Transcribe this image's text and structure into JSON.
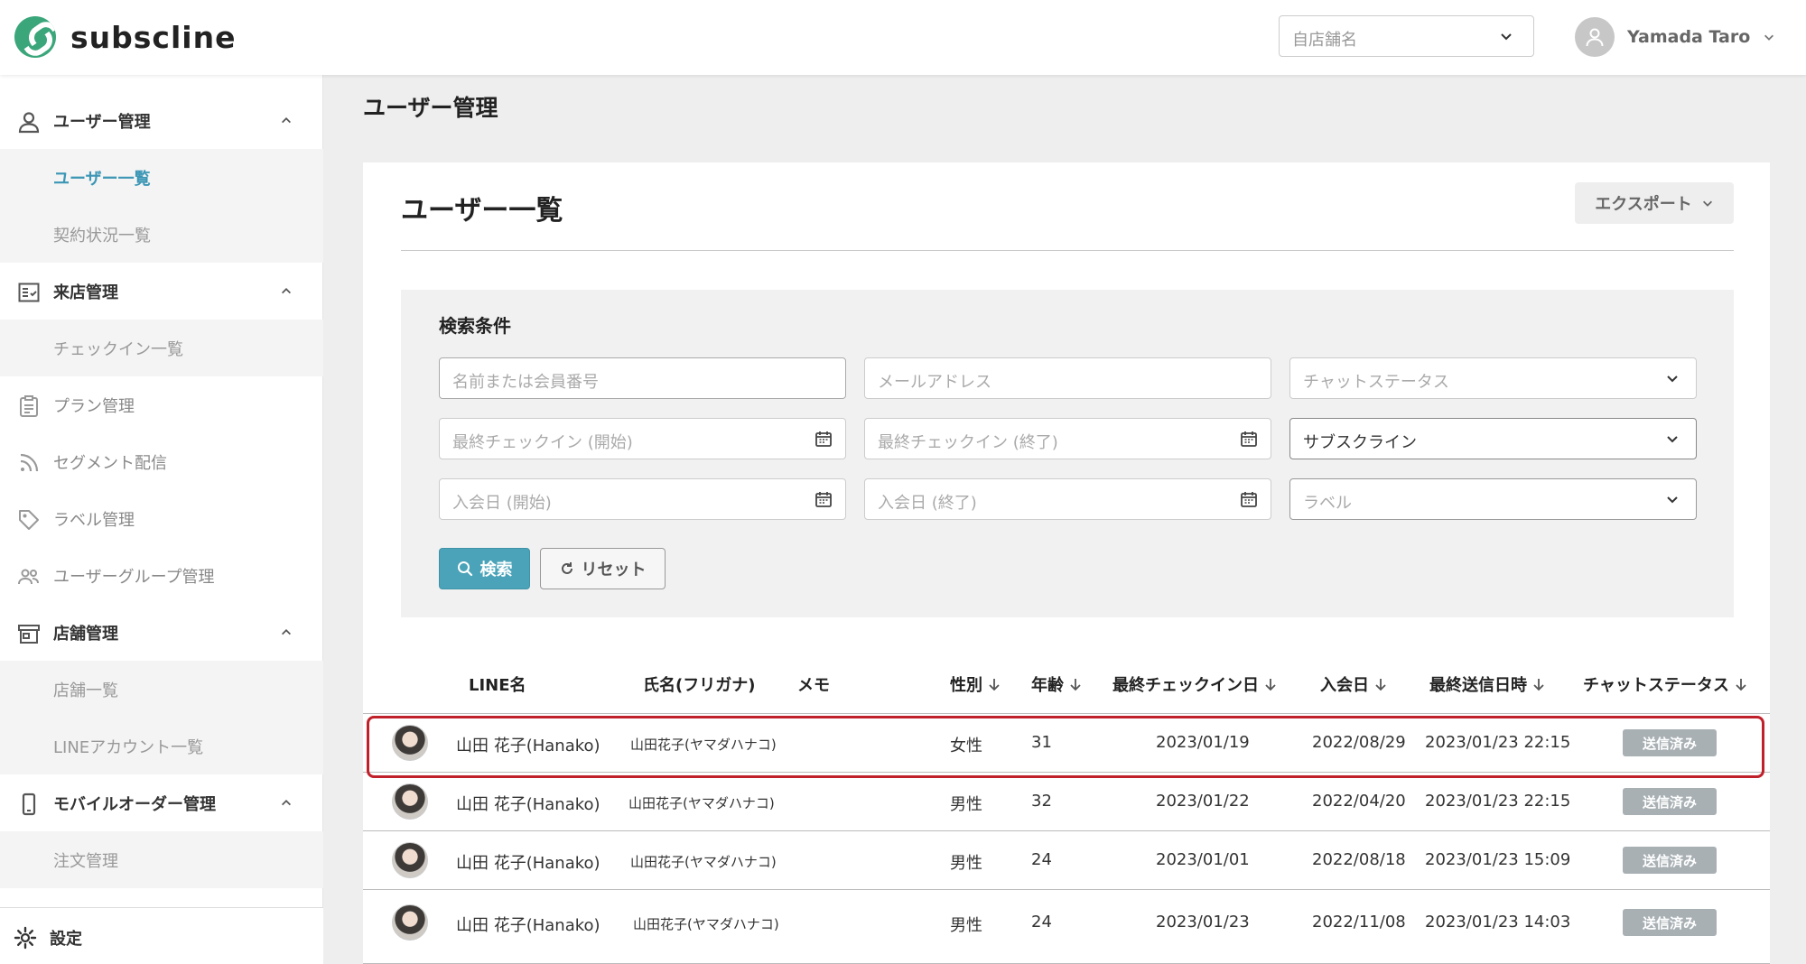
{
  "header": {
    "brand": "subscline",
    "store_select_placeholder": "自店舗名",
    "user_name": "Yamada Taro"
  },
  "sidebar": {
    "sections": [
      {
        "label": "ユーザー管理",
        "icon": "user-icon",
        "expanded": true,
        "children": [
          {
            "label": "ユーザー一覧",
            "active": true
          },
          {
            "label": "契約状況一覧",
            "active": false
          }
        ]
      },
      {
        "label": "来店管理",
        "icon": "checklist-icon",
        "expanded": true,
        "children": [
          {
            "label": "チェックイン一覧",
            "active": false
          }
        ]
      },
      {
        "label": "プラン管理",
        "icon": "clipboard-icon"
      },
      {
        "label": "セグメント配信",
        "icon": "rss-icon"
      },
      {
        "label": "ラベル管理",
        "icon": "tag-icon"
      },
      {
        "label": "ユーザーグループ管理",
        "icon": "group-icon"
      },
      {
        "label": "店舗管理",
        "icon": "store-icon",
        "expanded": true,
        "children": [
          {
            "label": "店舗一覧",
            "active": false
          },
          {
            "label": "LINEアカウント一覧",
            "active": false
          }
        ]
      },
      {
        "label": "モバイルオーダー管理",
        "icon": "mobile-icon",
        "expanded": true,
        "children": [
          {
            "label": "注文管理",
            "active": false
          }
        ]
      }
    ],
    "settings_label": "設定"
  },
  "page": {
    "title": "ユーザー管理",
    "card_title": "ユーザー一覧",
    "export_label": "エクスポート"
  },
  "search": {
    "title": "検索条件",
    "name_placeholder": "名前または会員番号",
    "email_placeholder": "メールアドレス",
    "chat_status_placeholder": "チャットステータス",
    "last_checkin_start_placeholder": "最終チェックイン (開始)",
    "last_checkin_end_placeholder": "最終チェックイン (終了)",
    "account_select_value": "サブスクライン",
    "join_start_placeholder": "入会日 (開始)",
    "join_end_placeholder": "入会日 (終了)",
    "label_placeholder": "ラベル",
    "search_button": "検索",
    "reset_button": "リセット"
  },
  "table": {
    "columns": {
      "line_name": "LINE名",
      "full_name": "氏名(フリガナ)",
      "memo": "メモ",
      "gender": "性別",
      "age": "年齢",
      "last_checkin": "最終チェックイン日",
      "join_date": "入会日",
      "last_sent": "最終送信日時",
      "chat_status": "チャットステータス"
    },
    "rows": [
      {
        "line_name": "山田 花子(Hanako)",
        "full_name": "山田花子(ヤマダハナコ)",
        "memo": "",
        "gender": "女性",
        "age": "31",
        "last_checkin": "2023/01/19",
        "join_date": "2022/08/29",
        "last_sent": "2023/01/23 22:15",
        "status": "送信済み",
        "highlighted": true
      },
      {
        "line_name": "山田 花子(Hanako)",
        "full_name": "山田花子(ヤマダハナコ)",
        "memo": "",
        "gender": "男性",
        "age": "32",
        "last_checkin": "2023/01/22",
        "join_date": "2022/04/20",
        "last_sent": "2023/01/23 22:15",
        "status": "送信済み"
      },
      {
        "line_name": "山田 花子(Hanako)",
        "full_name": "山田花子(ヤマダハナコ)",
        "memo": "",
        "gender": "男性",
        "age": "24",
        "last_checkin": "2023/01/01",
        "join_date": "2022/08/18",
        "last_sent": "2023/01/23 15:09",
        "status": "送信済み"
      },
      {
        "line_name": "山田 花子(Hanako)",
        "full_name": "山田花子(ヤマダハナコ)",
        "memo": "",
        "gender": "男性",
        "age": "24",
        "last_checkin": "2023/01/23",
        "join_date": "2022/11/08",
        "last_sent": "2023/01/23 14:03",
        "status": "送信済み"
      }
    ]
  },
  "colors": {
    "brand_green": "#3aa67a",
    "accent_teal": "#4aa3b8",
    "active_link": "#3b96b5",
    "highlight_border": "#c0202a",
    "status_badge": "#a8b0b4"
  }
}
